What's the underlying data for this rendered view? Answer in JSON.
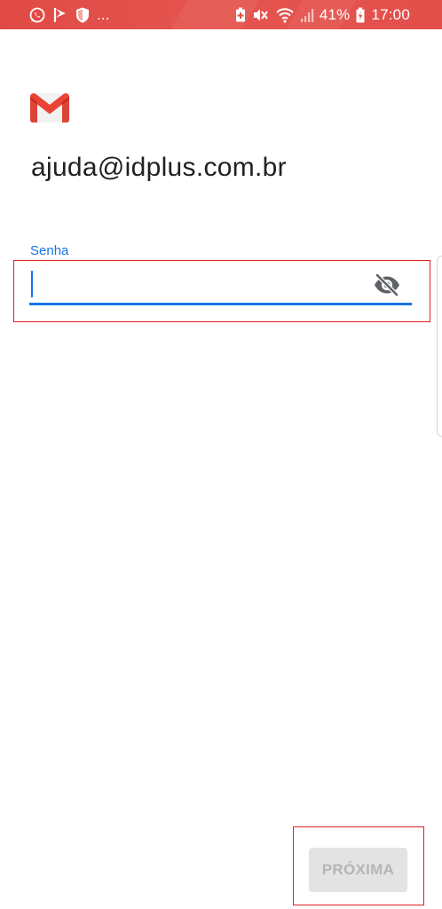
{
  "status_bar": {
    "left_icons": [
      "whatsapp-icon",
      "flag-icon",
      "shield-icon"
    ],
    "more_indicator": "...",
    "right_icons": [
      "battery-saver-icon",
      "mute-icon",
      "wifi-icon",
      "signal-icon",
      "battery-charging-icon"
    ],
    "battery_percent": "41%",
    "time": "17:00",
    "background_color": "#e3504b"
  },
  "app": {
    "logo": "gmail-logo"
  },
  "account": {
    "email": "ajuda@idplus.com.br"
  },
  "password_field": {
    "label": "Senha",
    "value": "",
    "toggle_icon": "visibility-off-icon",
    "accent_color": "#1a73e8"
  },
  "actions": {
    "next_label": "PRÓXIMA",
    "next_enabled": false
  },
  "annotations": {
    "highlight_color": "#e02020"
  }
}
